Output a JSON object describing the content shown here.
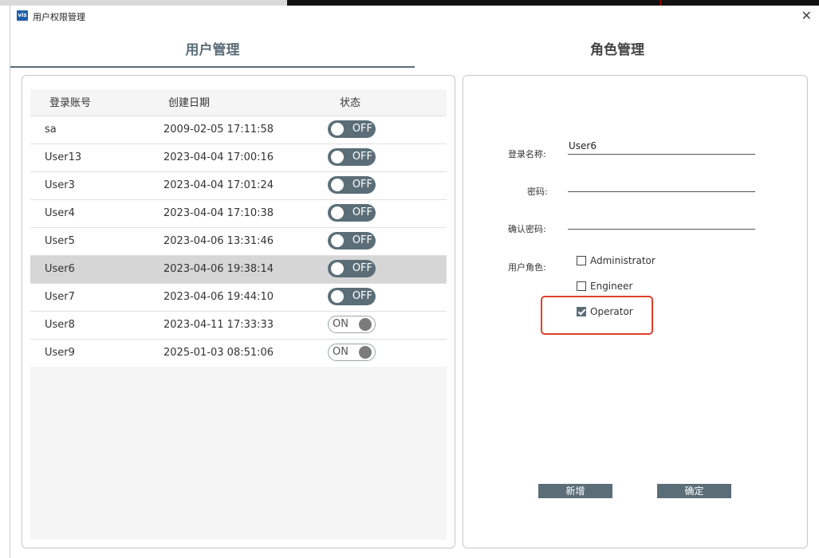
{
  "window": {
    "title": "用户权限管理",
    "icon_text": "vis",
    "close_glyph": "✕"
  },
  "tabs": [
    {
      "label": "用户管理",
      "active": true
    },
    {
      "label": "角色管理",
      "active": false
    }
  ],
  "user_table": {
    "columns": [
      "登录账号",
      "创建日期",
      "状态"
    ],
    "rows": [
      {
        "account": "sa",
        "created": "2009-02-05 17:11:58",
        "status": "OFF"
      },
      {
        "account": "User13",
        "created": "2023-04-04 17:00:16",
        "status": "OFF"
      },
      {
        "account": "User3",
        "created": "2023-04-04 17:01:24",
        "status": "OFF"
      },
      {
        "account": "User4",
        "created": "2023-04-04 17:10:38",
        "status": "OFF"
      },
      {
        "account": "User5",
        "created": "2023-04-06 13:31:46",
        "status": "OFF"
      },
      {
        "account": "User6",
        "created": "2023-04-06 19:38:14",
        "status": "OFF",
        "selected": true
      },
      {
        "account": "User7",
        "created": "2023-04-06 19:44:10",
        "status": "OFF"
      },
      {
        "account": "User8",
        "created": "2023-04-11 17:33:33",
        "status": "ON"
      },
      {
        "account": "User9",
        "created": "2025-01-03 08:51:06",
        "status": "ON"
      }
    ]
  },
  "form": {
    "login_name_label": "登录名称:",
    "login_name_value": "User6",
    "password_label": "密码:",
    "password_value": "",
    "confirm_label": "确认密码:",
    "confirm_value": "",
    "roles_label": "用户角色:",
    "roles": [
      {
        "name": "Administrator",
        "checked": false
      },
      {
        "name": "Engineer",
        "checked": false
      },
      {
        "name": "Operator",
        "checked": true
      }
    ],
    "add_button": "新增",
    "ok_button": "确定"
  },
  "colors": {
    "accent": "#5b6e78",
    "highlight": "#e0402a",
    "selected_row": "#d6d6d6"
  }
}
